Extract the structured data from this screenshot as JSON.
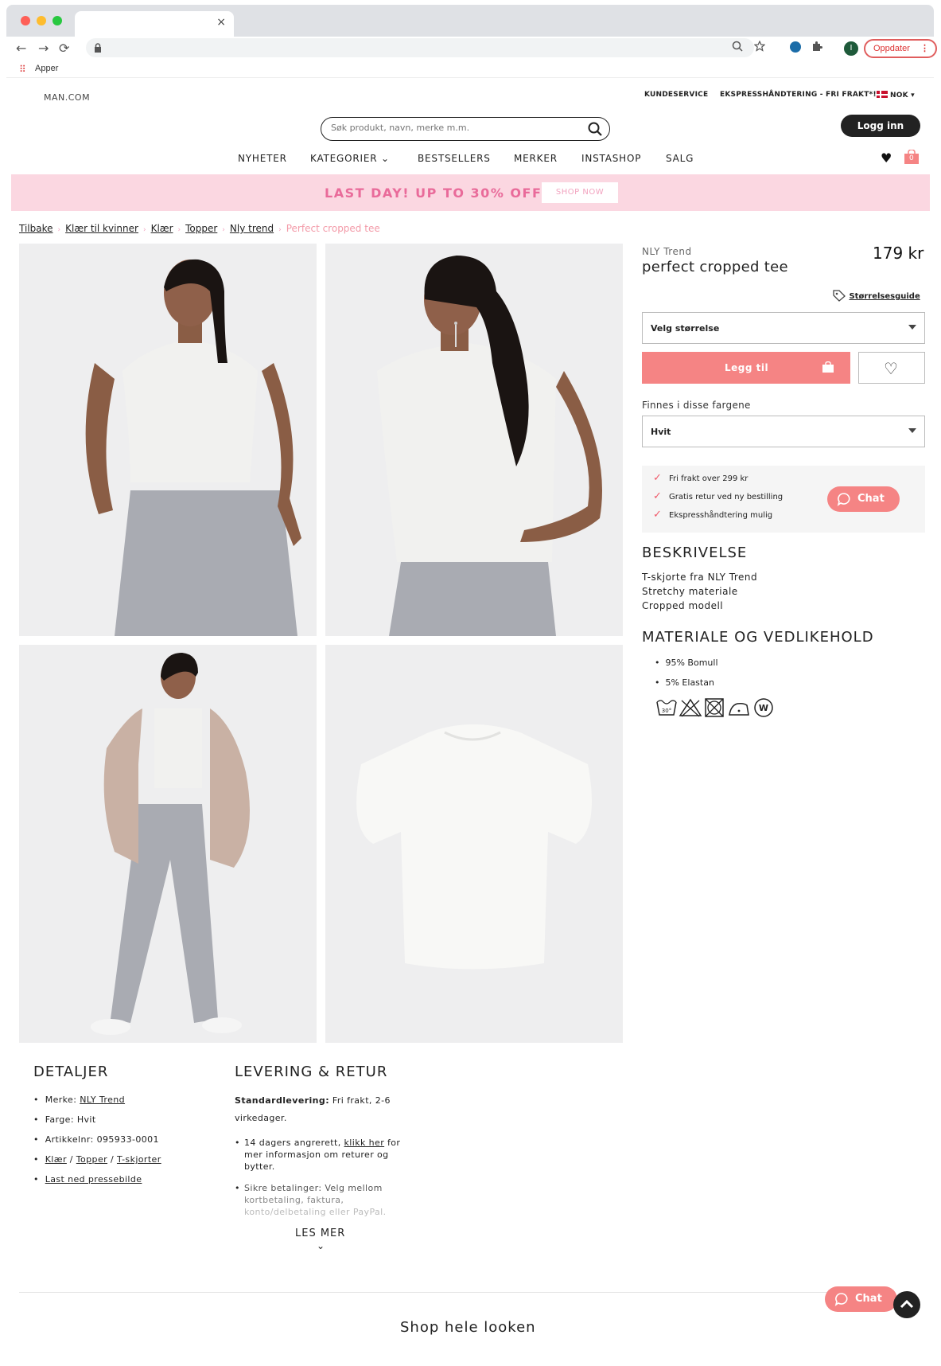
{
  "browser": {
    "tab_close": "×",
    "nav": {
      "back": "←",
      "forward": "→",
      "reload": "⟳"
    },
    "avatar_letter": "I",
    "update_label": "Oppdater",
    "update_menu": "⋮",
    "bookmarks": {
      "apps_label": "Apper"
    }
  },
  "site": {
    "logo": "MAN.COM",
    "util_links": [
      "KUNDESERVICE",
      "EKSPRESSHÅNDTERING - FRI FRAKT*!"
    ],
    "currency": "NOK",
    "search_placeholder": "Søk produkt, navn, merke m.m.",
    "login": "Logg inn",
    "nav": [
      "NYHETER",
      "KATEGORIER",
      "BESTSELLERS",
      "MERKER",
      "INSTASHOP",
      "SALG"
    ],
    "nav_dropdown_caret": "⌄",
    "bag_count": "0"
  },
  "promo": {
    "text": "LAST DAY! UP TO 30% OFF",
    "button": "SHOP NOW"
  },
  "breadcrumb": {
    "items": [
      "Tilbake",
      "Klær til kvinner",
      "Klær",
      "Topper",
      "Nly trend"
    ],
    "current": "Perfect cropped tee",
    "separator": "›"
  },
  "product": {
    "brand": "NLY Trend",
    "name": "perfect cropped tee",
    "price": "179 kr",
    "size_guide": "Størrelsesguide",
    "size_select": "Velg størrelse",
    "add_to_cart": "Legg til",
    "colors_label": "Finnes i disse fargene",
    "color_select": "Hvit",
    "usps": [
      "Fri frakt over 299 kr",
      "Gratis retur ved ny bestilling",
      "Ekspresshåndtering mulig"
    ],
    "chat": "Chat"
  },
  "description": {
    "title": "BESKRIVELSE",
    "lines": [
      "T-skjorte fra NLY Trend",
      "Stretchy materiale",
      "Cropped modell"
    ]
  },
  "material": {
    "title": "MATERIALE OG VEDLIKEHOLD",
    "items": [
      "95% Bomull",
      "5% Elastan"
    ],
    "care_wash": "30°",
    "care_pro": "W"
  },
  "details": {
    "title": "DETALJER",
    "brand_label": "Merke: ",
    "brand_value": "NLY Trend",
    "color": "Farge: Hvit",
    "article": "Artikkelnr: 095933-0001",
    "cat1": "Klær",
    "cat2": "Topper",
    "cat3": "T-skjorter",
    "cat_sep": " / ",
    "press": "Last ned pressebilde"
  },
  "delivery": {
    "title": "LEVERING & RETUR",
    "standard_label": "Standardlevering:",
    "standard_text": " Fri frakt, 2-6 virkedager.",
    "return_pre": "14 dagers angrerett, ",
    "return_link": "klikk her",
    "return_post": " for mer informasjon om returer og bytter.",
    "pay_1": "Sikre betalinger: Velg mellom",
    "pay_2": "kortbetaling, faktura,",
    "pay_3": "konto/delbetaling eller PayPal.",
    "read_more": "LES MER",
    "read_more_chevron": "⌄"
  },
  "footer": {
    "shop_look": "Shop hele looken",
    "chat": "Chat"
  },
  "colors": {
    "accent": "#f58484",
    "promo_bg": "#fbd7e1",
    "promo_text": "#e96b9a"
  }
}
